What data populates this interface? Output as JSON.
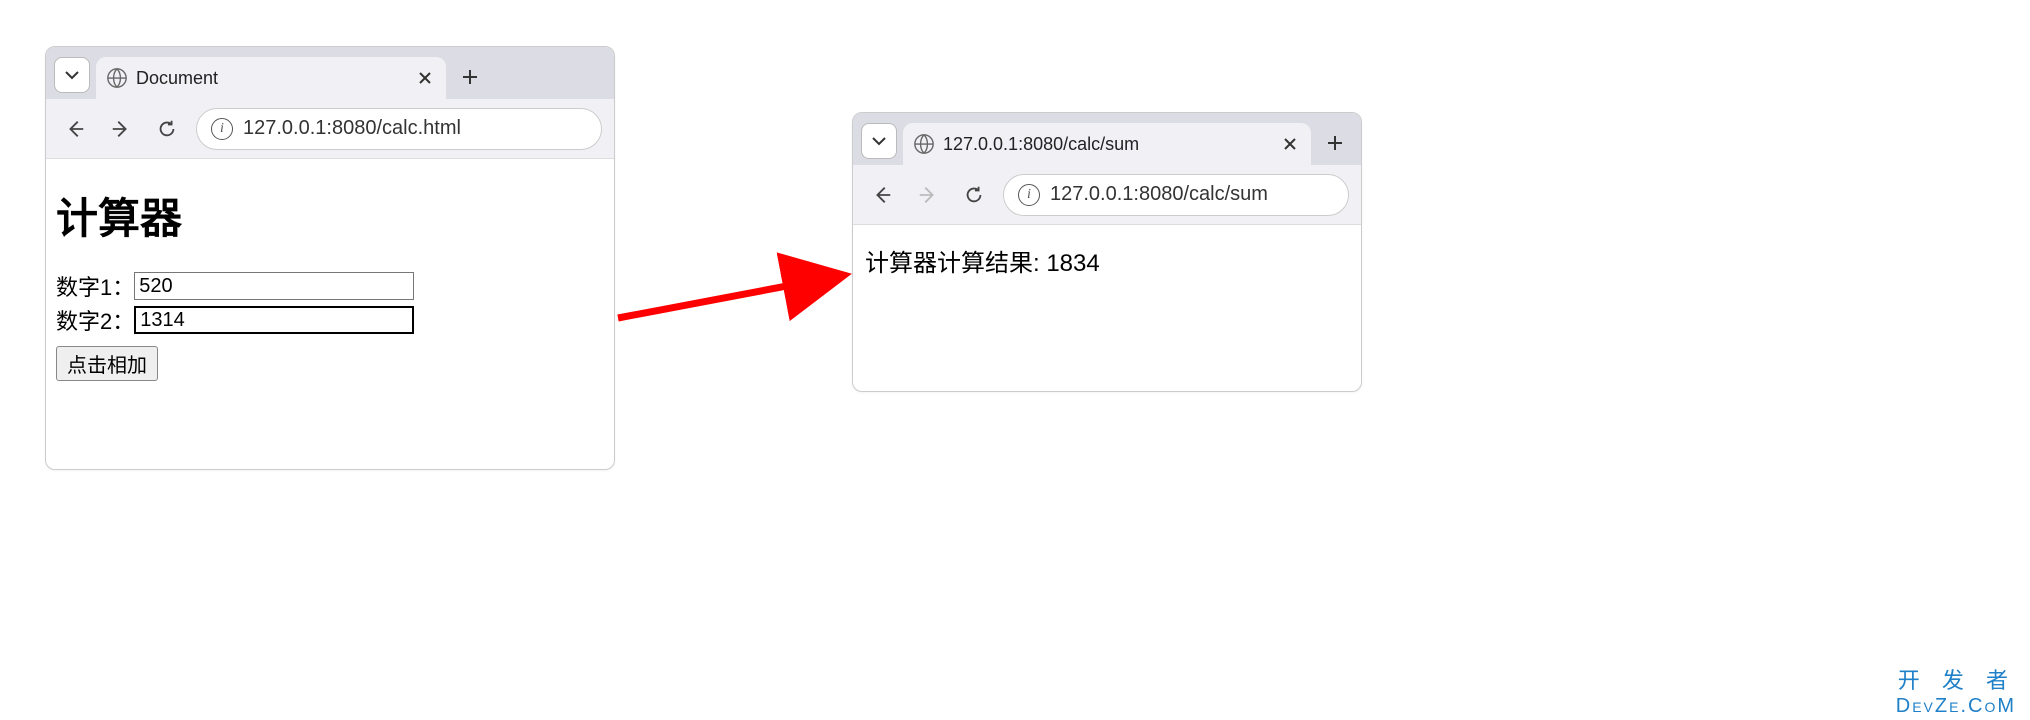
{
  "browser1": {
    "tab_title": "Document",
    "address": "127.0.0.1:8080/calc.html",
    "page_title": "计算器",
    "label_num1": "数字1：",
    "label_num2": "数字2：",
    "value_num1": "520",
    "value_num2": "1314",
    "submit_label": "点击相加"
  },
  "browser2": {
    "tab_title": "127.0.0.1:8080/calc/sum",
    "address": "127.0.0.1:8080/calc/sum",
    "result_text": "计算器计算结果: 1834"
  },
  "watermark": {
    "line1": "开 发 者",
    "line2": "DevZe.CoM"
  }
}
